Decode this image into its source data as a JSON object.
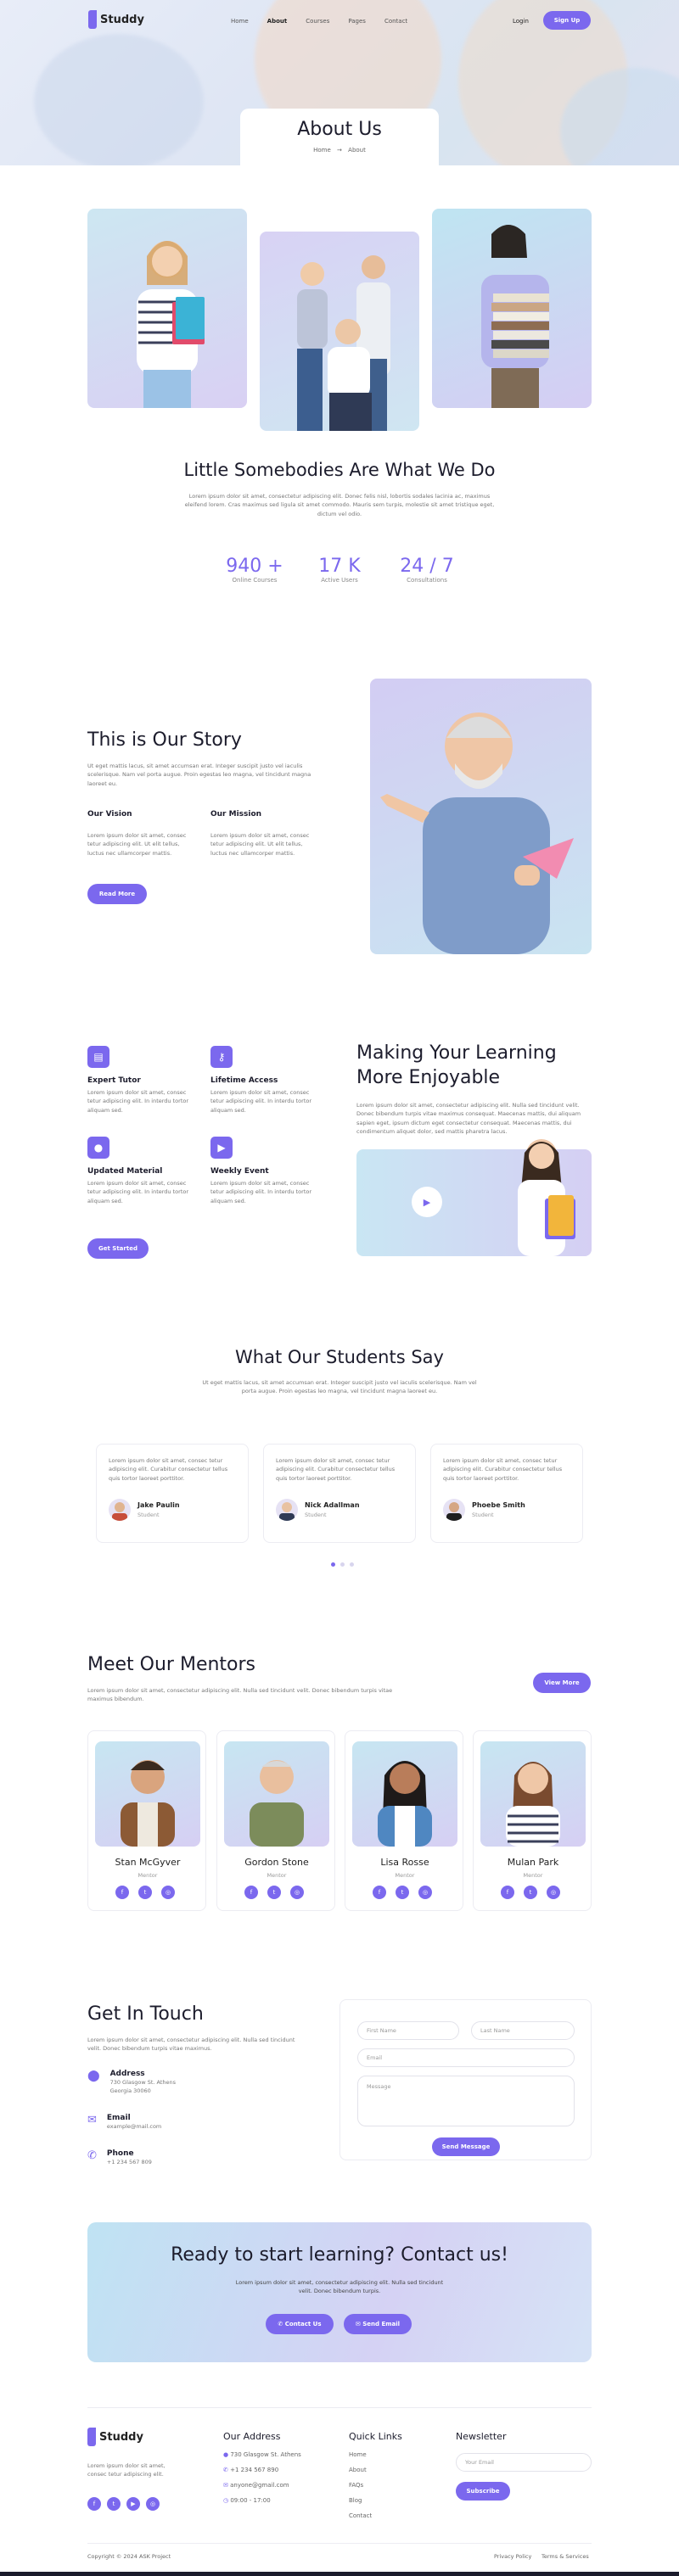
{
  "brand": {
    "logo_text": "Studdy",
    "accent": "#7b68ee"
  },
  "nav": {
    "links": [
      "Home",
      "About",
      "Courses",
      "Pages",
      "Contact"
    ],
    "login": "Login",
    "signup": "Sign Up"
  },
  "hero": {
    "title": "About Us",
    "crumb_home": "Home",
    "crumb_sep": "→",
    "crumb_current": "About"
  },
  "intro": {
    "title": "Little Somebodies Are What We Do",
    "text": "Lorem ipsum dolor sit amet, consectetur adipiscing elit. Donec felis nisl, lobortis sodales lacinia ac, maximus eleifend lorem. Cras maximus sed ligula sit amet commodo. Mauris sem turpis, molestie sit amet tristique eget, dictum vel odio.",
    "stats": [
      {
        "value": "940 +",
        "label": "Online Courses"
      },
      {
        "value": "17 K",
        "label": "Active Users"
      },
      {
        "value": "24 / 7",
        "label": "Consultations"
      }
    ]
  },
  "story": {
    "title": "This is Our Story",
    "text": "Ut eget mattis lacus, sit amet accumsan erat. Integer suscipit justo vel iaculis scelerisque. Nam vel porta augue. Proin egestas leo magna, vel tincidunt magna laoreet eu.",
    "vision_title": "Our Vision",
    "vision_text": "Lorem ipsum dolor sit amet, consec tetur adipiscing elit. Ut elit tellus, luctus nec ullamcorper mattis.",
    "mission_title": "Our Mission",
    "mission_text": "Lorem ipsum dolor sit amet, consec tetur adipiscing elit. Ut elit tellus, luctus nec ullamcorper mattis.",
    "button": "Read More"
  },
  "features": {
    "items": [
      {
        "title": "Expert Tutor",
        "text": "Lorem ipsum dolor sit amet, consec tetur adipiscing elit. In interdu tortor aliquam sed.",
        "icon": "clipboard-icon"
      },
      {
        "title": "Lifetime Access",
        "text": "Lorem ipsum dolor sit amet, consec tetur adipiscing elit. In interdu tortor aliquam sed.",
        "icon": "key-icon"
      },
      {
        "title": "Updated Material",
        "text": "Lorem ipsum dolor sit amet, consec tetur adipiscing elit. In interdu tortor aliquam sed.",
        "icon": "apple-icon"
      },
      {
        "title": "Weekly Event",
        "text": "Lorem ipsum dolor sit amet, consec tetur adipiscing elit. In interdu tortor aliquam sed.",
        "icon": "video-icon"
      }
    ],
    "button": "Get Started",
    "heading_line1": "Making Your Learning",
    "heading_line2": "More Enjoyable",
    "text": "Lorem ipsum dolor sit amet, consectetur adipiscing elit. Nulla sed tincidunt velit. Donec bibendum turpis vitae maximus consequat. Maecenas mattis, dui aliquam sapien eget, ipsum dictum eget consectetur consequat. Maecenas mattis, dui condimentum aliquet dolor, sed mattis pharetra lacus."
  },
  "testimonials": {
    "title": "What Our Students Say",
    "text": "Ut eget mattis lacus, sit amet accumsan erat. Integer suscipit justo vel iaculis scelerisque. Nam vel porta augue. Proin egestas leo magna, vel tincidunt magna laoreet eu.",
    "items": [
      {
        "quote": "Lorem ipsum dolor sit amet, consec tetur adipiscing elit. Curabitur consectetur tellus quis tortor laoreet porttitor.",
        "name": "Jake Paulin",
        "role": "Student"
      },
      {
        "quote": "Lorem ipsum dolor sit amet, consec tetur adipiscing elit. Curabitur consectetur tellus quis tortor laoreet porttitor.",
        "name": "Nick Adallman",
        "role": "Student"
      },
      {
        "quote": "Lorem ipsum dolor sit amet, consec tetur adipiscing elit. Curabitur consectetur tellus quis tortor laoreet porttitor.",
        "name": "Phoebe Smith",
        "role": "Student"
      }
    ]
  },
  "mentors": {
    "title": "Meet Our Mentors",
    "text": "Lorem ipsum dolor sit amet, consectetur adipiscing elit. Nulla sed tincidunt velit. Donec bibendum turpis vitae maximus bibendum.",
    "button": "View More",
    "items": [
      {
        "name": "Stan McGyver",
        "role": "Mentor"
      },
      {
        "name": "Gordon Stone",
        "role": "Mentor"
      },
      {
        "name": "Lisa Rosse",
        "role": "Mentor"
      },
      {
        "name": "Mulan Park",
        "role": "Mentor"
      }
    ]
  },
  "contact": {
    "title": "Get In Touch",
    "text": "Lorem ipsum dolor sit amet, consectetur adipiscing elit. Nulla sed tincidunt velit. Donec bibendum turpis vitae maximus.",
    "address_title": "Address",
    "address_line1": "730 Glasgow St. Athens",
    "address_line2": "Georgia 30060",
    "email_title": "Email",
    "email_value": "example@mail.com",
    "phone_title": "Phone",
    "phone_value": "+1 234 567 809",
    "form": {
      "first_name": "First Name",
      "last_name": "Last Name",
      "email": "Email",
      "message": "Message",
      "submit": "Send Message"
    }
  },
  "cta": {
    "title": "Ready to start learning? Contact us!",
    "text": "Lorem ipsum dolor sit amet, consectetur adipiscing elit. Nulla sed tincidunt velit. Donec bibendum turpis.",
    "btn_contact": "Contact Us",
    "btn_email": "Send Email"
  },
  "footer": {
    "logo_text": "Studdy",
    "about_text": "Lorem ipsum dolor sit amet, consec tetur adipiscing elit.",
    "address_head": "Our Address",
    "address_items": [
      "730 Glasgow St. Athens",
      "+1 234 567 890",
      "anyone@gmail.com",
      "09:00 - 17:00"
    ],
    "links_head": "Quick Links",
    "links": [
      "Home",
      "About",
      "FAQs",
      "Blog",
      "Contact"
    ],
    "newsletter_head": "Newsletter",
    "newsletter_placeholder": "Your Email",
    "subscribe": "Subscribe",
    "copyright": "Copyright © 2024 ASK Project",
    "privacy": "Privacy Policy",
    "terms": "Terms & Services"
  }
}
